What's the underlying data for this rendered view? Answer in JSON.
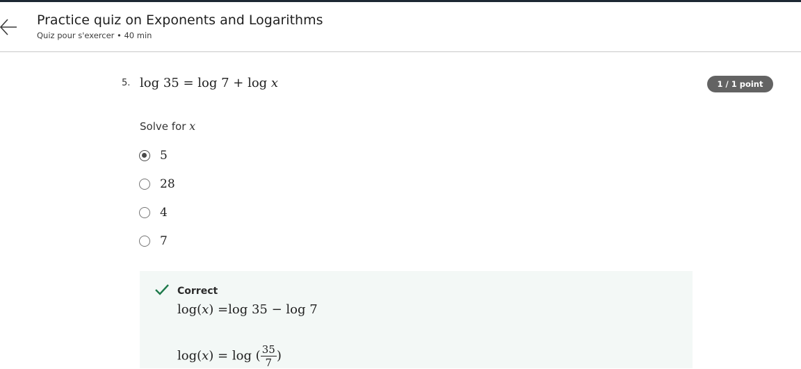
{
  "header": {
    "title": "Practice quiz on Exponents and Logarithms",
    "subtitle": "Quiz pour s'exercer • 40 min",
    "back_icon": "arrow-left-icon"
  },
  "question": {
    "number": "5.",
    "expr_part1": "log 35 = log 7 + log ",
    "expr_var": "x",
    "points": "1 / 1 point",
    "prompt_text": "Solve for ",
    "prompt_var": "x",
    "options": [
      {
        "label": "5",
        "selected": true
      },
      {
        "label": "28",
        "selected": false
      },
      {
        "label": "4",
        "selected": false
      },
      {
        "label": "7",
        "selected": false
      }
    ]
  },
  "feedback": {
    "status": "Correct",
    "status_color": "#1e7a4b",
    "line1_part1": "log(",
    "line1_var": "x",
    "line1_part2": ") =log 35 − log 7",
    "line2_part1": "log(",
    "line2_var": "x",
    "line2_part2": ") = log (",
    "line2_frac_num": "35",
    "line2_frac_den": "7",
    "line2_part3": ")"
  }
}
